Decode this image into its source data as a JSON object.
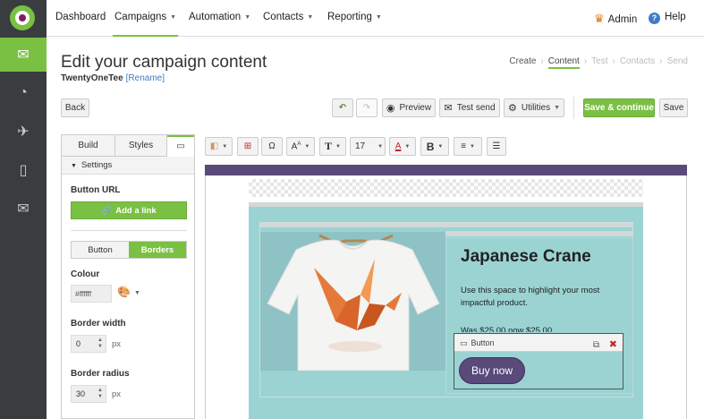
{
  "sidebar": {
    "items": [
      {
        "icon": "envelope-icon",
        "glyph": "✉"
      },
      {
        "icon": "pie-chart-icon",
        "glyph": "◔"
      },
      {
        "icon": "template-icon",
        "glyph": "✈"
      },
      {
        "icon": "mobile-icon",
        "glyph": "▯"
      },
      {
        "icon": "add-email-icon",
        "glyph": "✉"
      }
    ]
  },
  "nav": {
    "dashboard": "Dashboard",
    "campaigns": "Campaigns",
    "automation": "Automation",
    "contacts": "Contacts",
    "reporting": "Reporting",
    "admin": "Admin",
    "help": "Help"
  },
  "header": {
    "title": "Edit your campaign content",
    "campaign_name": "TwentyOneTee",
    "rename": "[Rename]",
    "steps": [
      "Create",
      "Content",
      "Test",
      "Contacts",
      "Send"
    ]
  },
  "toolbar": {
    "back": "Back",
    "preview": "Preview",
    "test_send": "Test send",
    "utilities": "Utilities",
    "save_continue": "Save & continue",
    "save": "Save"
  },
  "panel": {
    "tabs": {
      "build": "Build",
      "styles": "Styles"
    },
    "settings": "Settings",
    "button_url": "Button URL",
    "add_link": "Add a link",
    "seg_button": "Button",
    "seg_borders": "Borders",
    "colour": "Colour",
    "colour_value": "#ffffff",
    "border_width": "Border width",
    "border_width_value": "0",
    "border_radius": "Border radius",
    "border_radius_value": "30",
    "px": "px"
  },
  "editor_toolbar": {
    "font_size": "17",
    "omega": "Ω",
    "text_t": "T",
    "bold_b": "B"
  },
  "content": {
    "product_title": "Japanese Crane",
    "product_desc": "Use this space to highlight your most impactful product.",
    "price": "Was $25.00 now $25.00",
    "button_block_label": "Button",
    "buy_now": "Buy now"
  },
  "colors": {
    "brand_green": "#7ac043",
    "sidebar_dark": "#3a3d3f",
    "purple": "#5a4a7a",
    "teal": "#9bd3d3"
  }
}
